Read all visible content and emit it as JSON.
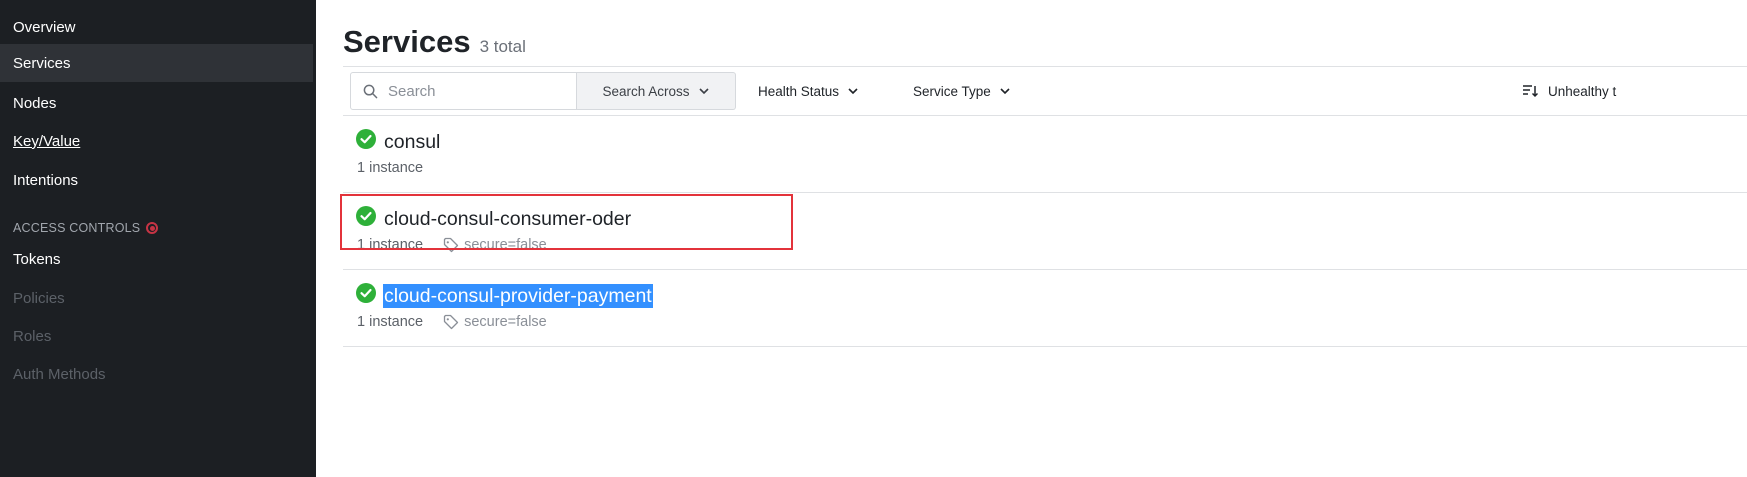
{
  "sidebar": {
    "items": [
      {
        "label": "Overview"
      },
      {
        "label": "Services"
      },
      {
        "label": "Nodes"
      },
      {
        "label": "Key/Value"
      },
      {
        "label": "Intentions"
      }
    ],
    "access_controls": {
      "heading": "ACCESS CONTROLS",
      "items": [
        {
          "label": "Tokens"
        },
        {
          "label": "Policies"
        },
        {
          "label": "Roles"
        },
        {
          "label": "Auth Methods"
        }
      ]
    }
  },
  "main": {
    "title": "Services",
    "count": "3 total",
    "search": {
      "placeholder": "Search",
      "value": ""
    },
    "filters": {
      "search_across": "Search Across",
      "health_status": "Health Status",
      "service_type": "Service Type",
      "sort": "Unhealthy t"
    },
    "services": [
      {
        "name": "consul",
        "instances": "1 instance",
        "tag": ""
      },
      {
        "name": "cloud-consul-consumer-oder",
        "instances": "1 instance",
        "tag": "secure=false"
      },
      {
        "name": "cloud-consul-provider-payment",
        "instances": "1 instance",
        "tag": "secure=false"
      }
    ]
  },
  "colors": {
    "sidebar_bg": "#1c1f23",
    "sidebar_active": "#2f3237",
    "status_ok": "#2eb039",
    "selection": "#3390ff",
    "highlight_box": "#e3333b"
  },
  "icons": {
    "search": "search-icon",
    "chevron": "chevron-down-icon",
    "sort": "sort-icon",
    "status": "check-circle-icon",
    "tag": "tag-icon",
    "alert": "alert-dot-icon"
  }
}
